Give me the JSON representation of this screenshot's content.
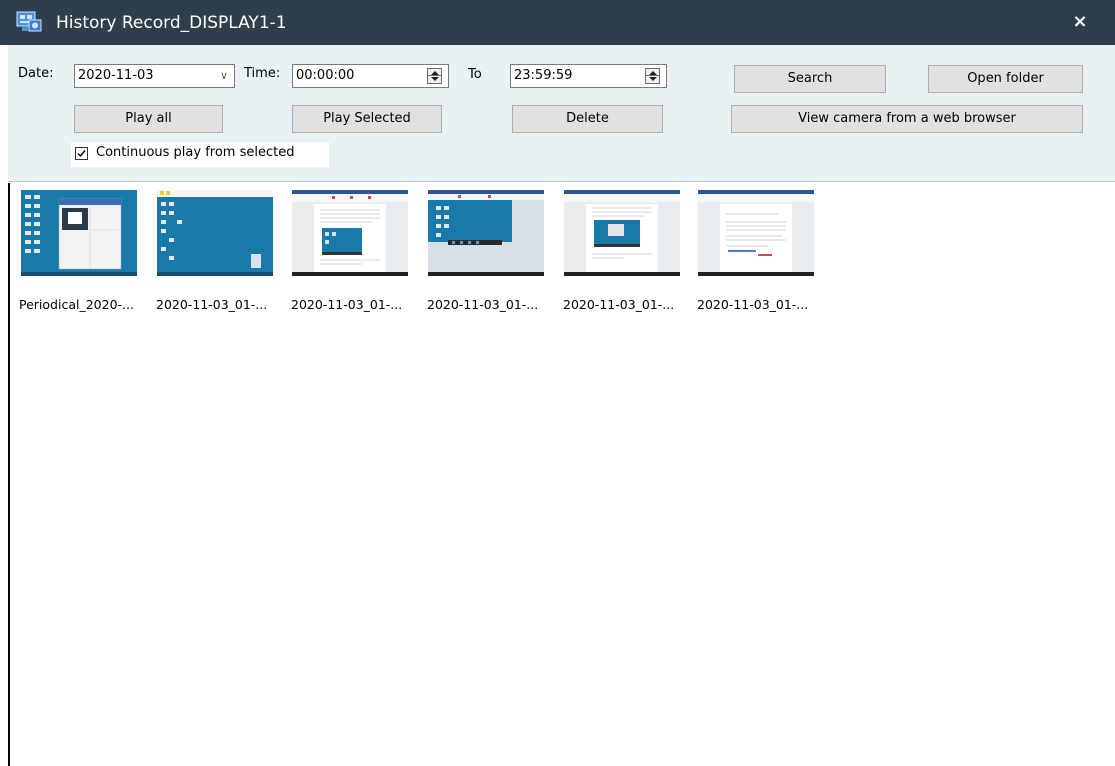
{
  "window": {
    "title": "History Record_DISPLAY1-1",
    "close_glyph": "×",
    "app_icon": "camera-display-icon"
  },
  "filters": {
    "date_label": "Date:",
    "date_value": "2020-11-03",
    "time_label": "Time:",
    "time_from": "00:00:00",
    "to_label": "To",
    "time_to": "23:59:59"
  },
  "buttons": {
    "search": "Search",
    "open_folder": "Open folder",
    "play_all": "Play all",
    "play_selected": "Play Selected",
    "delete": "Delete",
    "view_camera": "View camera from a web browser"
  },
  "options": {
    "continuous_play_label": "Continuous play from selected",
    "continuous_play_checked": true
  },
  "records": [
    {
      "label": "Periodical_2020-...",
      "thumb": "desktop-with-window"
    },
    {
      "label": "2020-11-03_01-...",
      "thumb": "blue-desktop"
    },
    {
      "label": "2020-11-03_01-...",
      "thumb": "document-with-image"
    },
    {
      "label": "2020-11-03_01-...",
      "thumb": "blue-window-panel"
    },
    {
      "label": "2020-11-03_01-...",
      "thumb": "document-with-blue-image"
    },
    {
      "label": "2020-11-03_01-...",
      "thumb": "text-document"
    }
  ],
  "colors": {
    "titlebar": "#2e3f4b",
    "toolbar_bg": "#e8f1f4",
    "desktop_blue": "#177aab"
  }
}
